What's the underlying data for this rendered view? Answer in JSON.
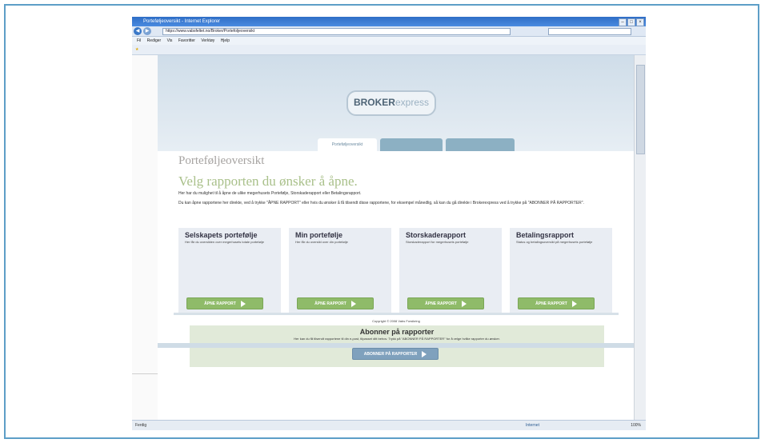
{
  "browser": {
    "title": "Porteføljeoversikt - Internet Explorer",
    "title_right": "",
    "address": "https://www.vabsfeltet.no/Broker/Portefoljeoversikt",
    "search_placeholder": "",
    "menu": [
      "Fil",
      "Rediger",
      "Vis",
      "Favoritter",
      "Verktøy",
      "Hjelp"
    ],
    "favorites": [],
    "status_left": "Ferdig",
    "status_zone": "Internet",
    "zoom": "100%"
  },
  "site": {
    "top_link": "",
    "logo_main": "BROKER",
    "logo_accent": "express",
    "logo_sub": "",
    "tabs": [
      {
        "label": "Porteføljeoversikt",
        "active": true
      },
      {
        "label": "",
        "active": false
      },
      {
        "label": "",
        "active": false
      }
    ]
  },
  "main": {
    "heading": "Porteføljeoversikt",
    "subheading": "Velg rapporten du ønsker å åpne.",
    "intro1": "Her har du mulighet til å åpne de ulike megerhusets Portefølje, Storskaderapport eller Betalingsrapport.",
    "intro2": "Du kan åpne rapportene her direkte, ved å trykke \"ÅPNE RAPPORT\" eller hvis du ønsker å få tilsendt disse rapportene, for eksempel månedlig, så kan du gå direkte i Brokerexpress ved å trykke på \"ABONNER PÅ RAPPORTER\".",
    "cards": [
      {
        "title": "Selskapets portefølje",
        "desc": "Her får du oversikten over megerhusets totale portefølje",
        "button": "ÅPNE RAPPORT"
      },
      {
        "title": "Min portefølje",
        "desc": "Her får du oversikt over din portefølje",
        "button": "ÅPNE RAPPORT"
      },
      {
        "title": "Storskaderapport",
        "desc": "Storskaderapport for megerhusets portefølje",
        "button": "ÅPNE RAPPORT"
      },
      {
        "title": "Betalingsrapport",
        "desc": "Status og betalingsoversikt på megerhusets portefølje",
        "button": "ÅPNE RAPPORT"
      }
    ],
    "subscribe": {
      "title": "Abonner på rapporter",
      "desc": "Her kan du få tilsendt rapportene til din e-post, tilpasset ditt behov. Trykk på \"ABONNER PÅ RAPPORTER\" for å velge hvilke rapporter du ønsker.",
      "button": "ABONNER PÅ RAPPORTER"
    },
    "footer": "Copyright © 2008 Vabs Forsikring"
  }
}
